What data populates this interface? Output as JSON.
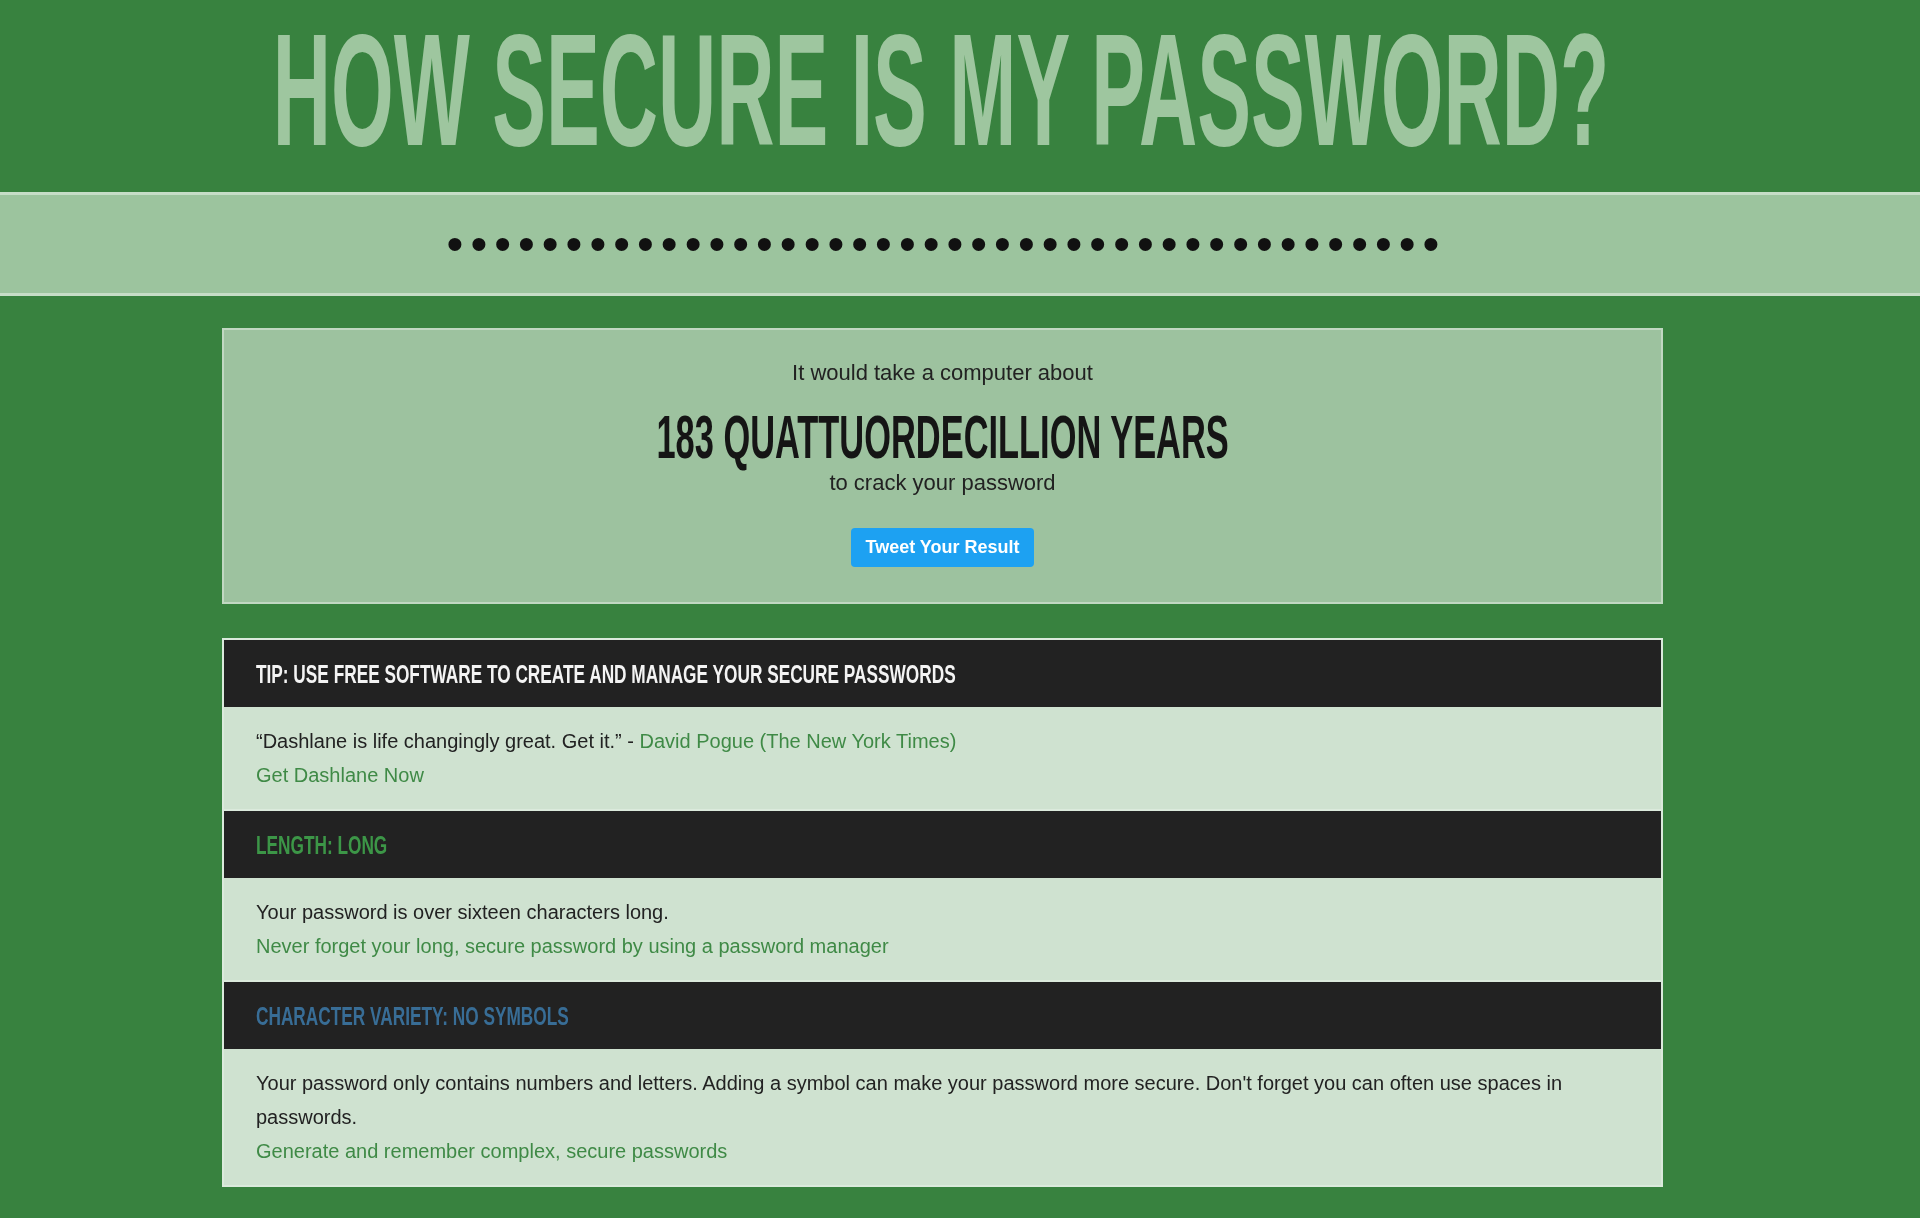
{
  "header": {
    "title": "HOW SECURE IS MY PASSWORD?"
  },
  "password_field": {
    "value": "••••••••••••••••••••••••••••••••••••••••••"
  },
  "result": {
    "intro": "It would take a computer about",
    "time": "183 QUATTUORDECILLION YEARS",
    "outro": "to crack your password",
    "button": "Tweet Your Result"
  },
  "sections": [
    {
      "heading": "TIP: USE FREE SOFTWARE TO CREATE AND MANAGE YOUR SECURE PASSWORDS",
      "color": "#f4f4f4",
      "text": "“Dashlane is life changingly great. Get it.” - ",
      "source": "David Pogue (The New York Times)",
      "link": "Get Dashlane Now"
    },
    {
      "heading": "LENGTH: LONG",
      "color": "#3c9647",
      "text": "Your password is over sixteen characters long.",
      "link": "Never forget your long, secure password by using a password manager"
    },
    {
      "heading": "CHARACTER VARIETY: NO SYMBOLS",
      "color": "#386d96",
      "text": "Your password only contains numbers and letters. Adding a symbol can make your password more secure. Don't forget you can often use spaces in passwords.",
      "link": "Generate and remember complex, secure passwords"
    }
  ]
}
